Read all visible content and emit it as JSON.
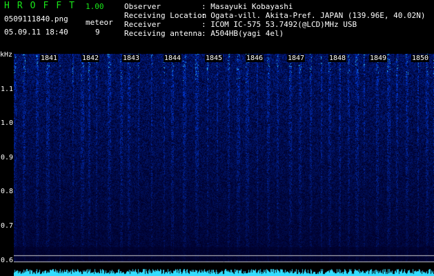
{
  "app": {
    "title": "HROFFT",
    "version": "1.00",
    "filename": "0509111840.png",
    "datetime": "05.09.11 18:40",
    "meteor_label": "meteor",
    "meteor_count": "9"
  },
  "info": [
    {
      "key": "Observer",
      "value": ": Masayuki Kobayashi"
    },
    {
      "key": "Receiving Location",
      "value": ": Ogata-vill. Akita-Pref. JAPAN (139.96E, 40.02N)"
    },
    {
      "key": "Receiver",
      "value": ": ICOM IC-575 53.7492(@LCD)MHz USB"
    },
    {
      "key": "Receiving antenna",
      "value": ": A504HB(yagi 4el)"
    }
  ],
  "axis": {
    "unit": "kHz",
    "freq_labels": [
      "1.1",
      "1.0",
      "0.9",
      "0.8",
      "0.7",
      "0.6"
    ],
    "time_labels": [
      "1841",
      "1842",
      "1843",
      "1844",
      "1845",
      "1846",
      "1847",
      "1848",
      "1849",
      "1850"
    ]
  },
  "colors": {
    "title": "#19e619",
    "text": "#ffffff",
    "signal": "#2e4cff",
    "hot": "#33ccff",
    "line": "#55ffee"
  }
}
